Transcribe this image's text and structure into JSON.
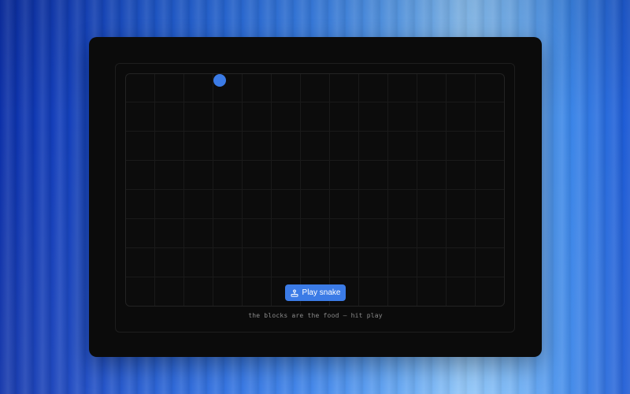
{
  "theme": {
    "accent": "#3b7be6",
    "card_bg": "#0b0b0b"
  },
  "game": {
    "food_color": "#3b7be6",
    "play_button": {
      "label": "Play snake",
      "icon": "joystick-icon"
    },
    "hint": "the blocks are the food — hit play"
  }
}
